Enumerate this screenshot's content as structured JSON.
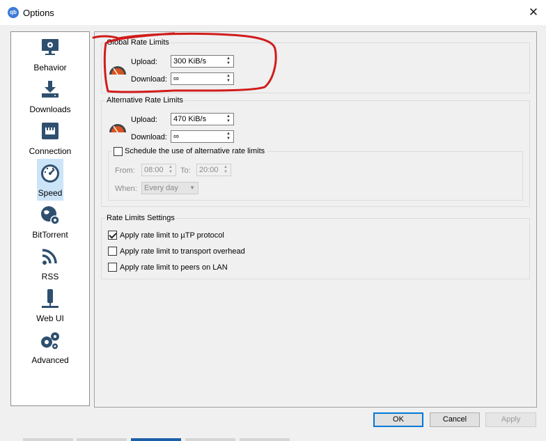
{
  "window": {
    "title": "Options",
    "app_icon_text": "qb"
  },
  "sidebar": {
    "items": [
      {
        "label": "Behavior",
        "icon": "monitor-gear-icon"
      },
      {
        "label": "Downloads",
        "icon": "download-icon"
      },
      {
        "label": "Connection",
        "icon": "network-port-icon"
      },
      {
        "label": "Speed",
        "icon": "speedometer-icon",
        "active": true
      },
      {
        "label": "BitTorrent",
        "icon": "globe-gear-icon"
      },
      {
        "label": "RSS",
        "icon": "rss-icon"
      },
      {
        "label": "Web UI",
        "icon": "network-plug-icon"
      },
      {
        "label": "Advanced",
        "icon": "gears-icon"
      }
    ]
  },
  "global": {
    "title": "Global Rate Limits",
    "upload_label": "Upload:",
    "upload_value": "300 KiB/s",
    "download_label": "Download:",
    "download_value": "∞"
  },
  "alternative": {
    "title": "Alternative Rate Limits",
    "upload_label": "Upload:",
    "upload_value": "470 KiB/s",
    "download_label": "Download:",
    "download_value": "∞",
    "schedule_label": "Schedule the use of alternative rate limits",
    "schedule_checked": false,
    "from_label": "From:",
    "from_value": "08:00",
    "to_label": "To:",
    "to_value": "20:00",
    "when_label": "When:",
    "when_value": "Every day"
  },
  "settings": {
    "title": "Rate Limits Settings",
    "options": [
      {
        "label": "Apply rate limit to µTP protocol",
        "checked": true
      },
      {
        "label": "Apply rate limit to transport overhead",
        "checked": false
      },
      {
        "label": "Apply rate limit to peers on LAN",
        "checked": false
      }
    ]
  },
  "buttons": {
    "ok": "OK",
    "cancel": "Cancel",
    "apply": "Apply"
  },
  "colors": {
    "accent": "#0078d7",
    "selection": "#cce4f7",
    "icon": "#2f4f6f",
    "annotation": "#d11b1b"
  }
}
